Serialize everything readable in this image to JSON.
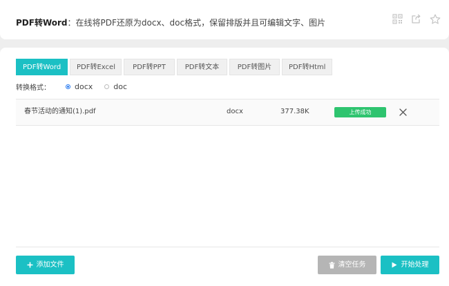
{
  "header": {
    "title_strong": "PDF转Word",
    "title_rest": "：在线将PDF还原为docx、doc格式，保留排版并且可编辑文字、图片",
    "icons": [
      "qr-code-icon",
      "share-icon",
      "star-icon"
    ]
  },
  "tabs": [
    {
      "label": "PDF转Word",
      "active": true
    },
    {
      "label": "PDF转Excel",
      "active": false
    },
    {
      "label": "PDF转PPT",
      "active": false
    },
    {
      "label": "PDF转文本",
      "active": false
    },
    {
      "label": "PDF转图片",
      "active": false
    },
    {
      "label": "PDF转Html",
      "active": false
    }
  ],
  "format": {
    "label": "转换格式：",
    "options": [
      {
        "label": "docx",
        "selected": true
      },
      {
        "label": "doc",
        "selected": false
      }
    ]
  },
  "files": [
    {
      "name": "春节活动的通知(1).pdf",
      "format": "docx",
      "size": "377.38K",
      "status": "上传成功"
    }
  ],
  "buttons": {
    "add_file": "添加文件",
    "clear_tasks": "清空任务",
    "start_process": "开始处理"
  },
  "colors": {
    "accent": "#1bc0c4",
    "success": "#2ec46f",
    "disabled": "#b5b5b5",
    "radio": "#2b7cf0"
  }
}
